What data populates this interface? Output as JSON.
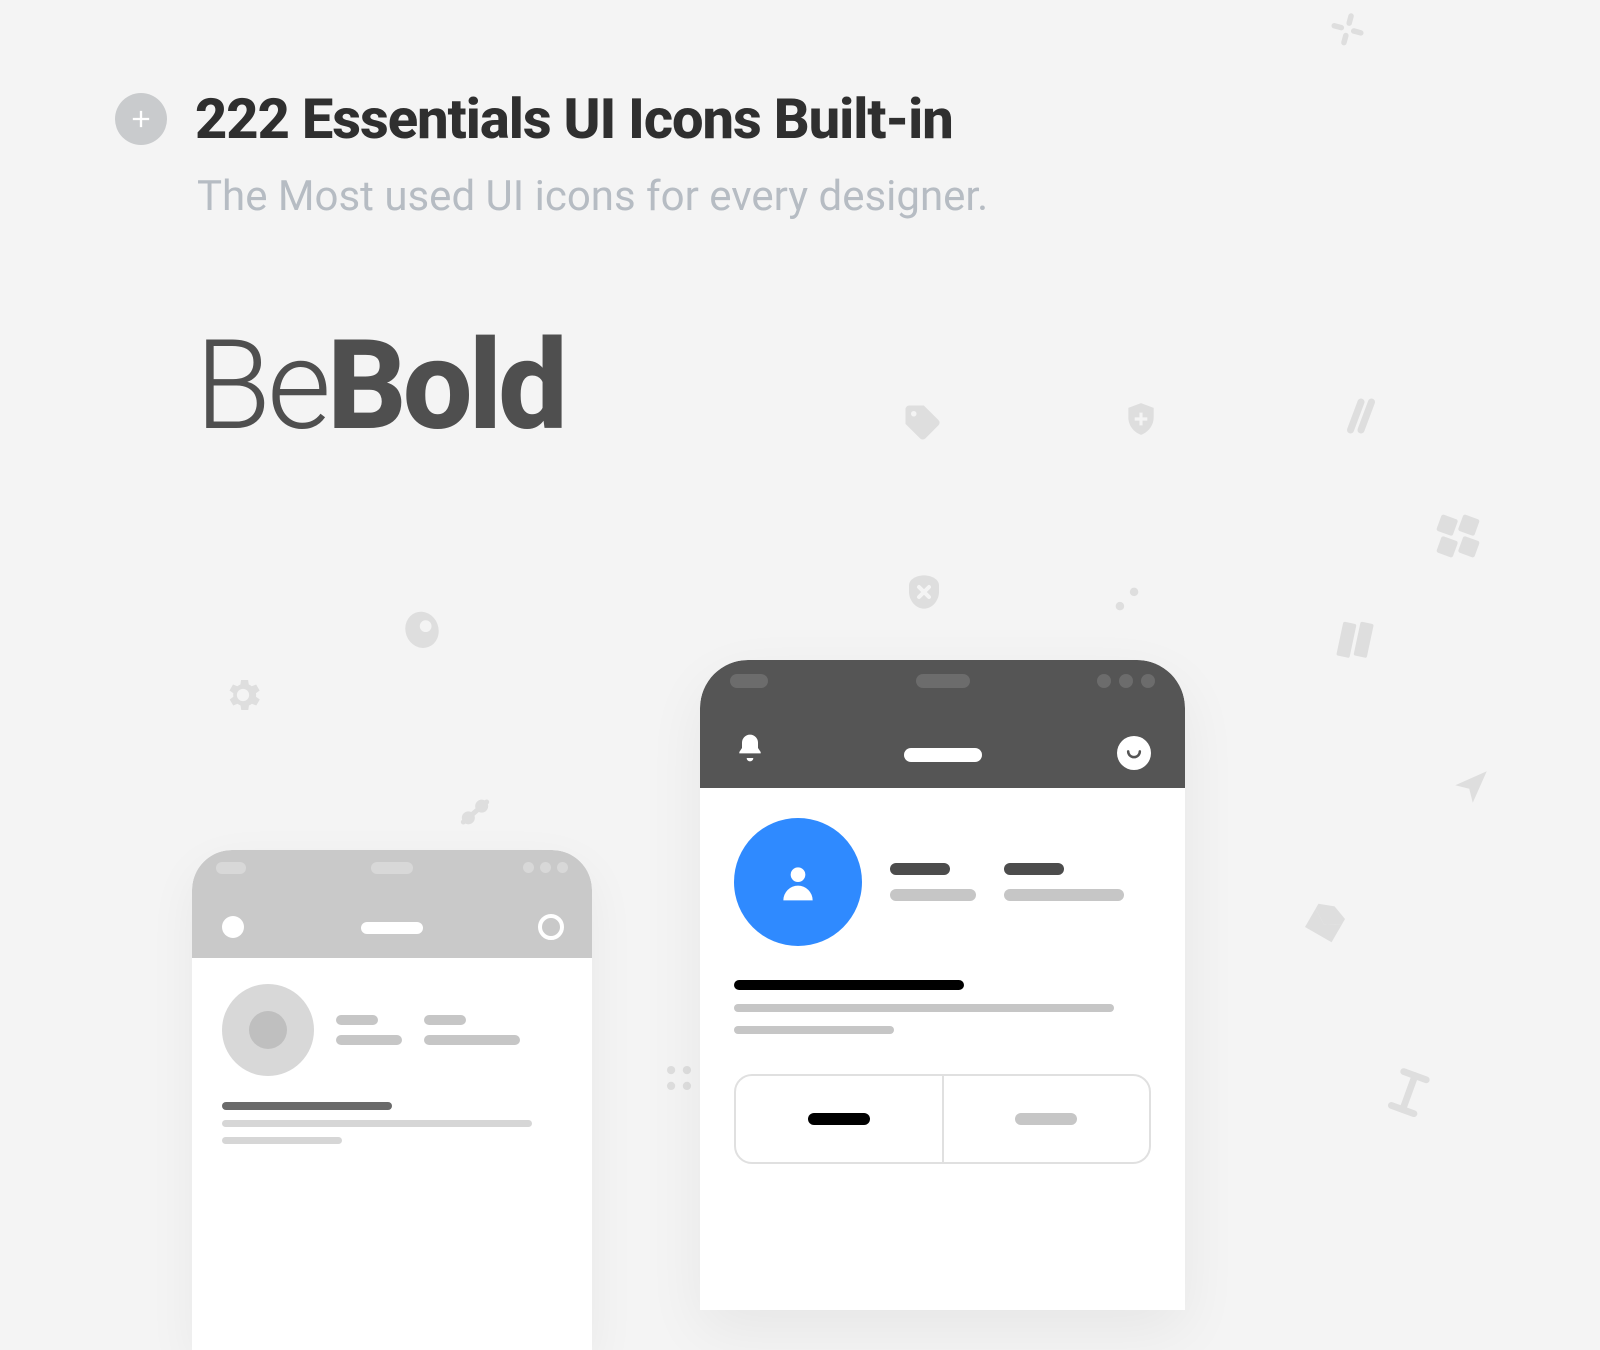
{
  "header": {
    "title": "222 Essentials UI Icons Built-in",
    "subtitle": "The Most used UI icons for every designer."
  },
  "wordmark": {
    "thin": "Be",
    "bold": "Bold"
  },
  "colors": {
    "accent": "#2f8aff",
    "ghost": "#dedede",
    "dark": "#555555"
  }
}
